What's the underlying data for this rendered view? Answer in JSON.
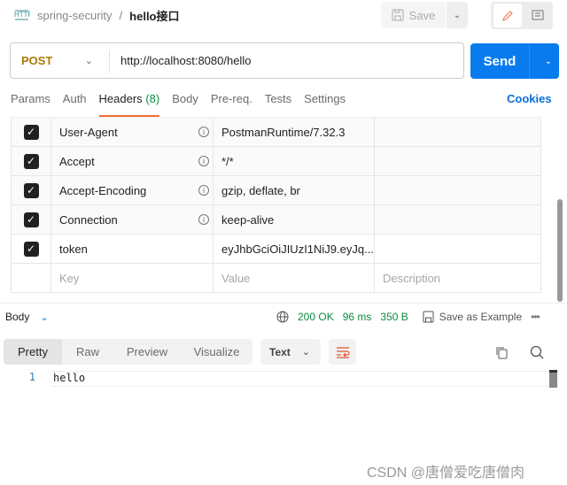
{
  "header": {
    "collection": "spring-security",
    "separator": "/",
    "request_name": "hello接口",
    "save_label": "Save"
  },
  "request": {
    "method": "POST",
    "url": "http://localhost:8080/hello",
    "send_label": "Send"
  },
  "tabs": [
    {
      "label": "Params"
    },
    {
      "label": "Auth"
    },
    {
      "label": "Headers",
      "count": "(8)",
      "active": true
    },
    {
      "label": "Body"
    },
    {
      "label": "Pre-req."
    },
    {
      "label": "Tests"
    },
    {
      "label": "Settings"
    }
  ],
  "cookies_label": "Cookies",
  "headers": [
    {
      "key": "User-Agent",
      "value": "PostmanRuntime/7.32.3",
      "info": true
    },
    {
      "key": "Accept",
      "value": "*/*",
      "info": true
    },
    {
      "key": "Accept-Encoding",
      "value": "gzip, deflate, br",
      "info": true
    },
    {
      "key": "Connection",
      "value": "keep-alive",
      "info": true
    },
    {
      "key": "token",
      "value": "eyJhbGciOiJIUzI1NiJ9.eyJq...",
      "info": false
    }
  ],
  "placeholders": {
    "key": "Key",
    "value": "Value",
    "description": "Description"
  },
  "response": {
    "body_label": "Body",
    "status": "200 OK",
    "time": "96 ms",
    "size": "350 B",
    "save_example": "Save as Example",
    "formats": [
      "Pretty",
      "Raw",
      "Preview",
      "Visualize"
    ],
    "active_format": "Pretty",
    "type": "Text",
    "lines": [
      {
        "n": "1",
        "text": "hello"
      }
    ]
  },
  "watermark": "CSDN @唐僧爱吃唐僧肉",
  "colors": {
    "accent": "#097bed",
    "status": "#0e8a3e",
    "method": "#ad7a03",
    "active_tab": "#f26b3a"
  }
}
